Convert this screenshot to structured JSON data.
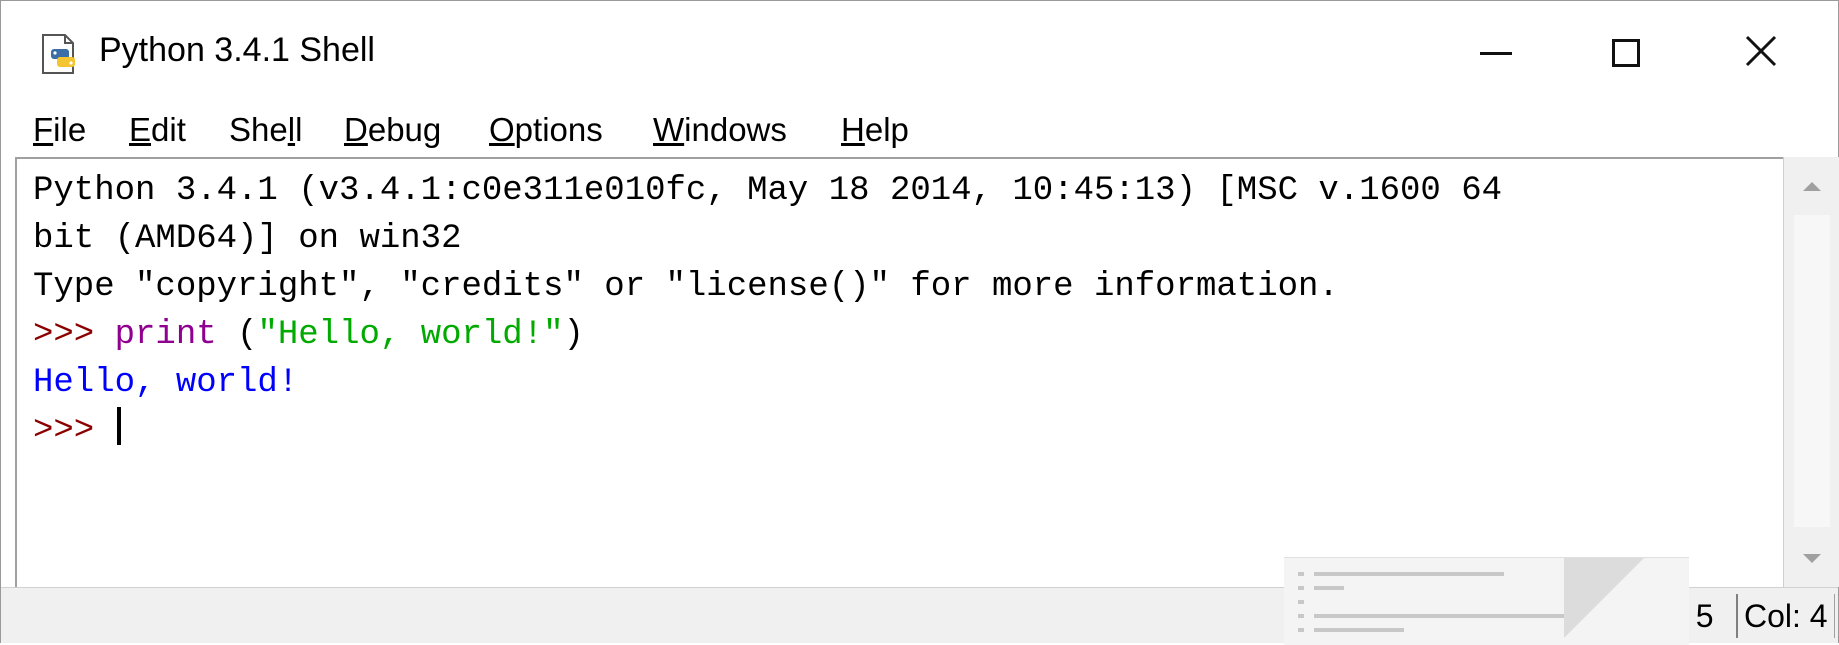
{
  "window": {
    "title": "Python 3.4.1 Shell",
    "controls": {
      "minimize": "minimize",
      "maximize": "maximize",
      "close": "✕"
    }
  },
  "menu": {
    "items": [
      {
        "label_pre": "",
        "mnemonic": "F",
        "label_post": "ile"
      },
      {
        "label_pre": "",
        "mnemonic": "E",
        "label_post": "dit"
      },
      {
        "label_pre": "She",
        "mnemonic": "l",
        "label_post": "l"
      },
      {
        "label_pre": "",
        "mnemonic": "D",
        "label_post": "ebug"
      },
      {
        "label_pre": "",
        "mnemonic": "O",
        "label_post": "ptions"
      },
      {
        "label_pre": "",
        "mnemonic": "W",
        "label_post": "indows"
      },
      {
        "label_pre": "",
        "mnemonic": "H",
        "label_post": "elp"
      }
    ]
  },
  "shell": {
    "banner_line1": "Python 3.4.1 (v3.4.1:c0e311e010fc, May 18 2014, 10:45:13) [MSC v.1600 64",
    "banner_line2": "bit (AMD64)] on win32",
    "banner_line3": "Type \"copyright\", \"credits\" or \"license()\" for more information.",
    "prompt": ">>> ",
    "cmd_builtin": "print",
    "cmd_open": " (",
    "cmd_string": "\"Hello, world!\"",
    "cmd_close": ")",
    "output": "Hello, world!",
    "prompt2": ">>> "
  },
  "status": {
    "line": "Ln: 5",
    "line_visible": ": 5",
    "col": "Col: 4"
  },
  "colors": {
    "prompt": "#8b0000",
    "builtin": "#900090",
    "string": "#00aa00",
    "output": "#0000ff"
  }
}
